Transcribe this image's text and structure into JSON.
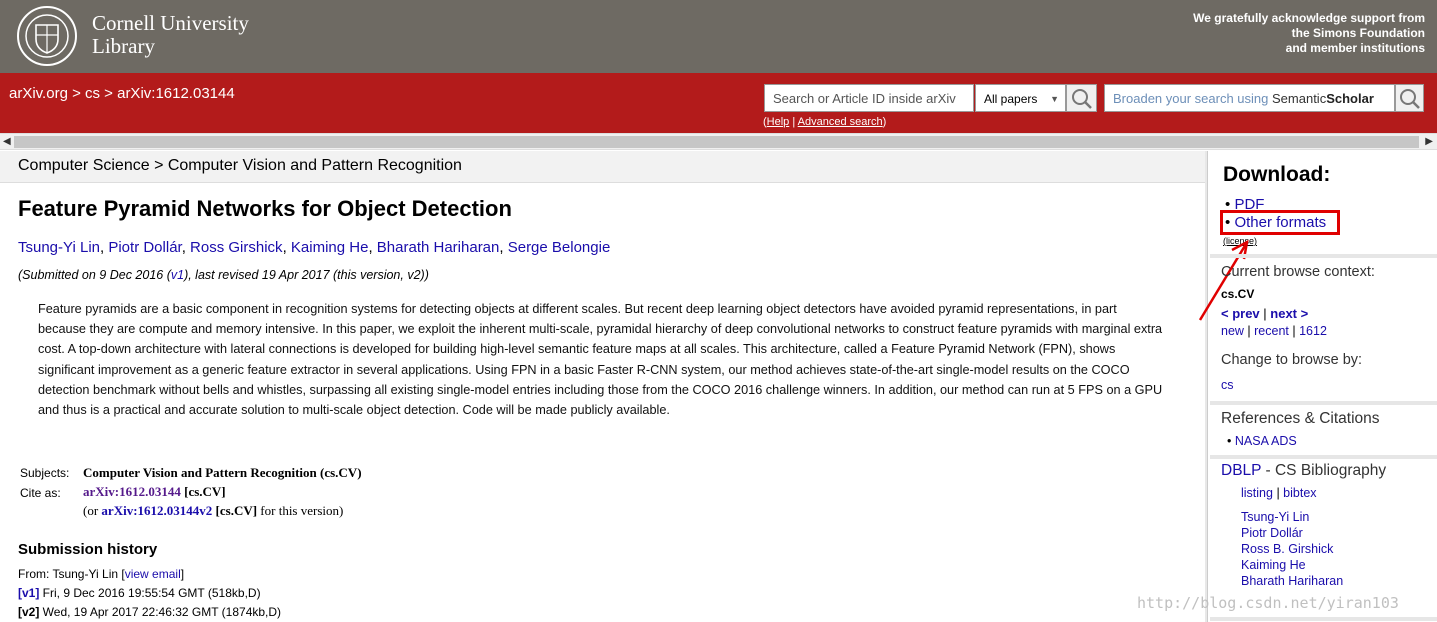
{
  "header": {
    "library_line1": "Cornell University",
    "library_line2": "Library",
    "support_line1": "We gratefully acknowledge support from",
    "support_line2": "the Simons Foundation",
    "support_line3": "and member institutions"
  },
  "breadcrumb": "arXiv.org > cs > arXiv:1612.03144",
  "search": {
    "placeholder": "Search or Article ID inside arXiv",
    "select_value": "All papers",
    "scholar_placeholder": "Broaden your search using",
    "scholar_brand_a": "Semantic",
    "scholar_brand_b": "Scholar",
    "help_open": "(",
    "help_label": "Help",
    "help_sep": " | ",
    "advanced_label": "Advanced search",
    "help_close": ")"
  },
  "subheader": "Computer Science > Computer Vision and Pattern Recognition",
  "paper": {
    "title": "Feature Pyramid Networks for Object Detection",
    "authors": [
      "Tsung-Yi Lin",
      "Piotr Dollár",
      "Ross Girshick",
      "Kaiming He",
      "Bharath Hariharan",
      "Serge Belongie"
    ],
    "author_sep": ", ",
    "date_prefix": "(Submitted on 9 Dec 2016 (",
    "date_v1": "v1",
    "date_suffix": "), last revised 19 Apr 2017 (this version, v2))",
    "abstract": "Feature pyramids are a basic component in recognition systems for detecting objects at different scales. But recent deep learning object detectors have avoided pyramid representations, in part because they are compute and memory intensive. In this paper, we exploit the inherent multi-scale, pyramidal hierarchy of deep convolutional networks to construct feature pyramids with marginal extra cost. A top-down architecture with lateral connections is developed for building high-level semantic feature maps at all scales. This architecture, called a Feature Pyramid Network (FPN), shows significant improvement as a generic feature extractor in several applications. Using FPN in a basic Faster R-CNN system, our method achieves state-of-the-art single-model results on the COCO detection benchmark without bells and whistles, surpassing all existing single-model entries including those from the COCO 2016 challenge winners. In addition, our method can run at 5 FPS on a GPU and thus is a practical and accurate solution to multi-scale object detection. Code will be made publicly available.",
    "subjects_label": "Subjects:",
    "subjects_value": "Computer Vision and Pattern Recognition (cs.CV)",
    "cite_label": "Cite as:",
    "cite_id": "arXiv:1612.03144",
    "cite_cat": " [cs.CV]",
    "cite2_prefix": "(or ",
    "cite2_id": "arXiv:1612.03144v2",
    "cite2_cat": " [cs.CV]",
    "cite2_suffix": " for this version)"
  },
  "history": {
    "title": "Submission history",
    "from_prefix": "From: Tsung-Yi Lin [",
    "view_email": "view email",
    "from_suffix": "]",
    "versions": [
      {
        "tag": "[v1]",
        "text": " Fri, 9 Dec 2016 19:55:54 GMT (518kb,D)"
      },
      {
        "tag": "[v2]",
        "text": " Wed, 19 Apr 2017 22:46:32 GMT (1874kb,D)"
      }
    ]
  },
  "sidebar": {
    "download_title": "Download:",
    "pdf": "PDF",
    "other_formats": "Other formats",
    "license": "(license)",
    "browse_context_label": "Current browse context:",
    "browse_context_value": "cs.CV",
    "prev": "< prev",
    "next": "next >",
    "nav_sep": " | ",
    "new": "new",
    "recent": "recent",
    "month": "1612",
    "change_browse": "Change to browse by:",
    "cs": "cs",
    "refs_title": "References & Citations",
    "nasa_ads": "NASA ADS",
    "dblp": "DBLP",
    "dblp_suffix": " - CS Bibliography",
    "listing": "listing",
    "bibtex": "bibtex",
    "dblp_authors": [
      "Tsung-Yi Lin",
      "Piotr Dollár",
      "Ross B. Girshick",
      "Kaiming He",
      "Bharath Hariharan"
    ]
  },
  "watermark": "http://blog.csdn.net/yiran103",
  "colors": {
    "header_gray": "#6e6a63",
    "arxiv_red": "#b31b1b",
    "link_blue": "#1a0dab",
    "annotation_red": "#e00000"
  }
}
